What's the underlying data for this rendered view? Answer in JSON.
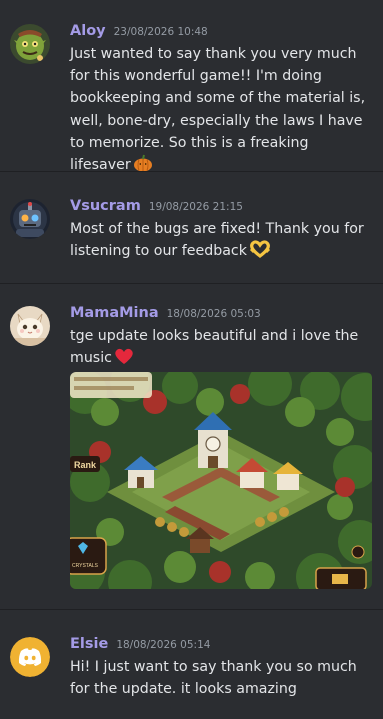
{
  "messages": [
    {
      "username": "Aloy",
      "timestamp": "23/08/2026 10:48",
      "text": "Just wanted to say thank you very much for this wonderful game!! I'm doing bookkeeping and some of the material is, well, bone-dry, especially the laws I have to memorize. So this is a freaking lifesaver",
      "emoji": "pumpkin-emoji",
      "avatar": "goblin-avatar"
    },
    {
      "username": "Vsucram",
      "timestamp": "19/08/2026 21:15",
      "text": "Most of the bugs are fixed! Thank you for listening to our feedback",
      "emoji": "heart-hands-emoji",
      "avatar": "robot-avatar"
    },
    {
      "username": "MamaMina",
      "timestamp": "18/08/2026 05:03",
      "text": "tge update looks beautiful and i love the music",
      "emoji": "red-heart-emoji",
      "avatar": "cat-avatar",
      "attachment": {
        "type": "game-screenshot",
        "overlay_labels": [
          "Rank",
          "CRYSTALS"
        ]
      }
    },
    {
      "username": "Elsie",
      "timestamp": "18/08/2026 05:14",
      "text": "Hi! I just want to say thank you so much for the update. it looks amazing",
      "avatar": "discord-logo-avatar"
    }
  ],
  "colors": {
    "background": "#2b2d31",
    "username": "#a49be6",
    "timestamp": "#949ba4",
    "text": "#e3e5e8",
    "divider": "#1f2023",
    "discord_blurple": "#f0b232"
  }
}
